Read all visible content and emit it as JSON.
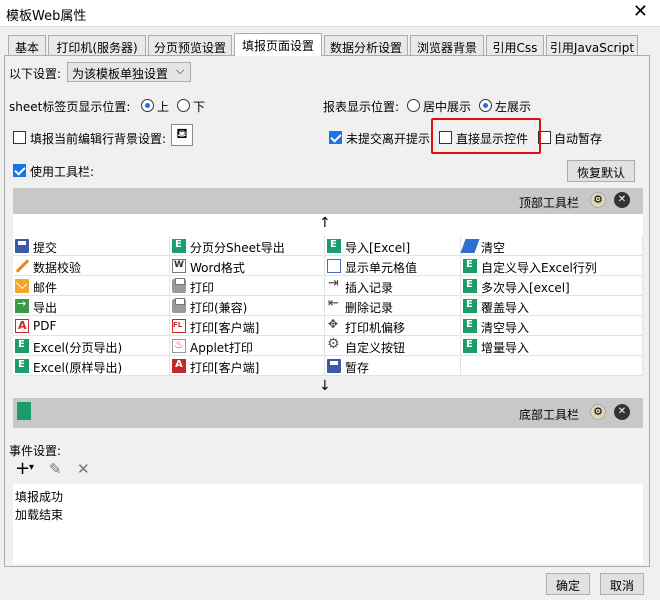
{
  "window": {
    "title": "模板Web属性"
  },
  "tabs": [
    {
      "label": "基本",
      "active": false
    },
    {
      "label": "打印机(服务器)",
      "active": false
    },
    {
      "label": "分页预览设置",
      "active": false
    },
    {
      "label": "填报页面设置",
      "active": true
    },
    {
      "label": "数据分析设置",
      "active": false
    },
    {
      "label": "浏览器背景",
      "active": false
    },
    {
      "label": "引用Css",
      "active": false
    },
    {
      "label": "引用JavaScript",
      "active": false
    }
  ],
  "settings": {
    "scope_label": "以下设置:",
    "scope_value": "为该模板单独设置",
    "sheet_pos_label": "sheet标签页显示位置:",
    "sheet_pos_options": [
      "上",
      "下"
    ],
    "sheet_pos_selected": "上",
    "report_pos_label": "报表显示位置:",
    "report_pos_options": [
      "居中展示",
      "左展示"
    ],
    "report_pos_selected": "左展示",
    "fill_bg_label": "填报当前编辑行背景设置:",
    "fill_bg_checked": false,
    "unsubmitted_label": "未提交离开提示",
    "unsubmitted_checked": true,
    "direct_ctrl_label": "直接显示控件",
    "direct_ctrl_checked": false,
    "autosave_label": "自动暂存",
    "autosave_checked": false,
    "use_toolbar_label": "使用工具栏:",
    "use_toolbar_checked": true,
    "restore_label": "恢复默认",
    "top_toolbar_label": "顶部工具栏",
    "bottom_toolbar_label": "底部工具栏"
  },
  "toolbar_items": [
    [
      "提交",
      "分页分Sheet导出",
      "导入[Excel]",
      "清空"
    ],
    [
      "数据校验",
      "Word格式",
      "显示单元格值",
      "自定义导入Excel行列"
    ],
    [
      "邮件",
      "打印",
      "插入记录",
      "多次导入[excel]"
    ],
    [
      "导出",
      "打印(兼容)",
      "删除记录",
      "覆盖导入"
    ],
    [
      "PDF",
      "打印[客户端]",
      "打印机偏移",
      "清空导入"
    ],
    [
      "Excel(分页导出)",
      "Applet打印",
      "自定义按钮",
      "增量导入"
    ],
    [
      "Excel(原样导出)",
      "打印[客户端]",
      "暂存",
      ""
    ]
  ],
  "toolbar_icons": [
    [
      "save-icon",
      "excel-icon",
      "excel-icon",
      "clear-icon"
    ],
    [
      "pencil-icon",
      "word-icon",
      "frame-icon",
      "excel-icon"
    ],
    [
      "mail-icon",
      "printer-icon",
      "insert-row-icon",
      "excel-icon"
    ],
    [
      "export-icon",
      "printer-icon",
      "delete-row-icon",
      "excel-icon"
    ],
    [
      "pdf-icon",
      "fl-print-icon",
      "move-icon",
      "excel-icon"
    ],
    [
      "excel-icon",
      "applet-icon",
      "gear-icon",
      "excel-icon"
    ],
    [
      "excel-icon",
      "pdf-print-icon",
      "save-icon",
      ""
    ]
  ],
  "events": {
    "label": "事件设置:",
    "items": [
      "填报成功",
      "加载结束"
    ]
  },
  "footer": {
    "ok": "确定",
    "cancel": "取消"
  },
  "colors": {
    "accent": "#1a73e8",
    "highlight": "#e01010"
  }
}
